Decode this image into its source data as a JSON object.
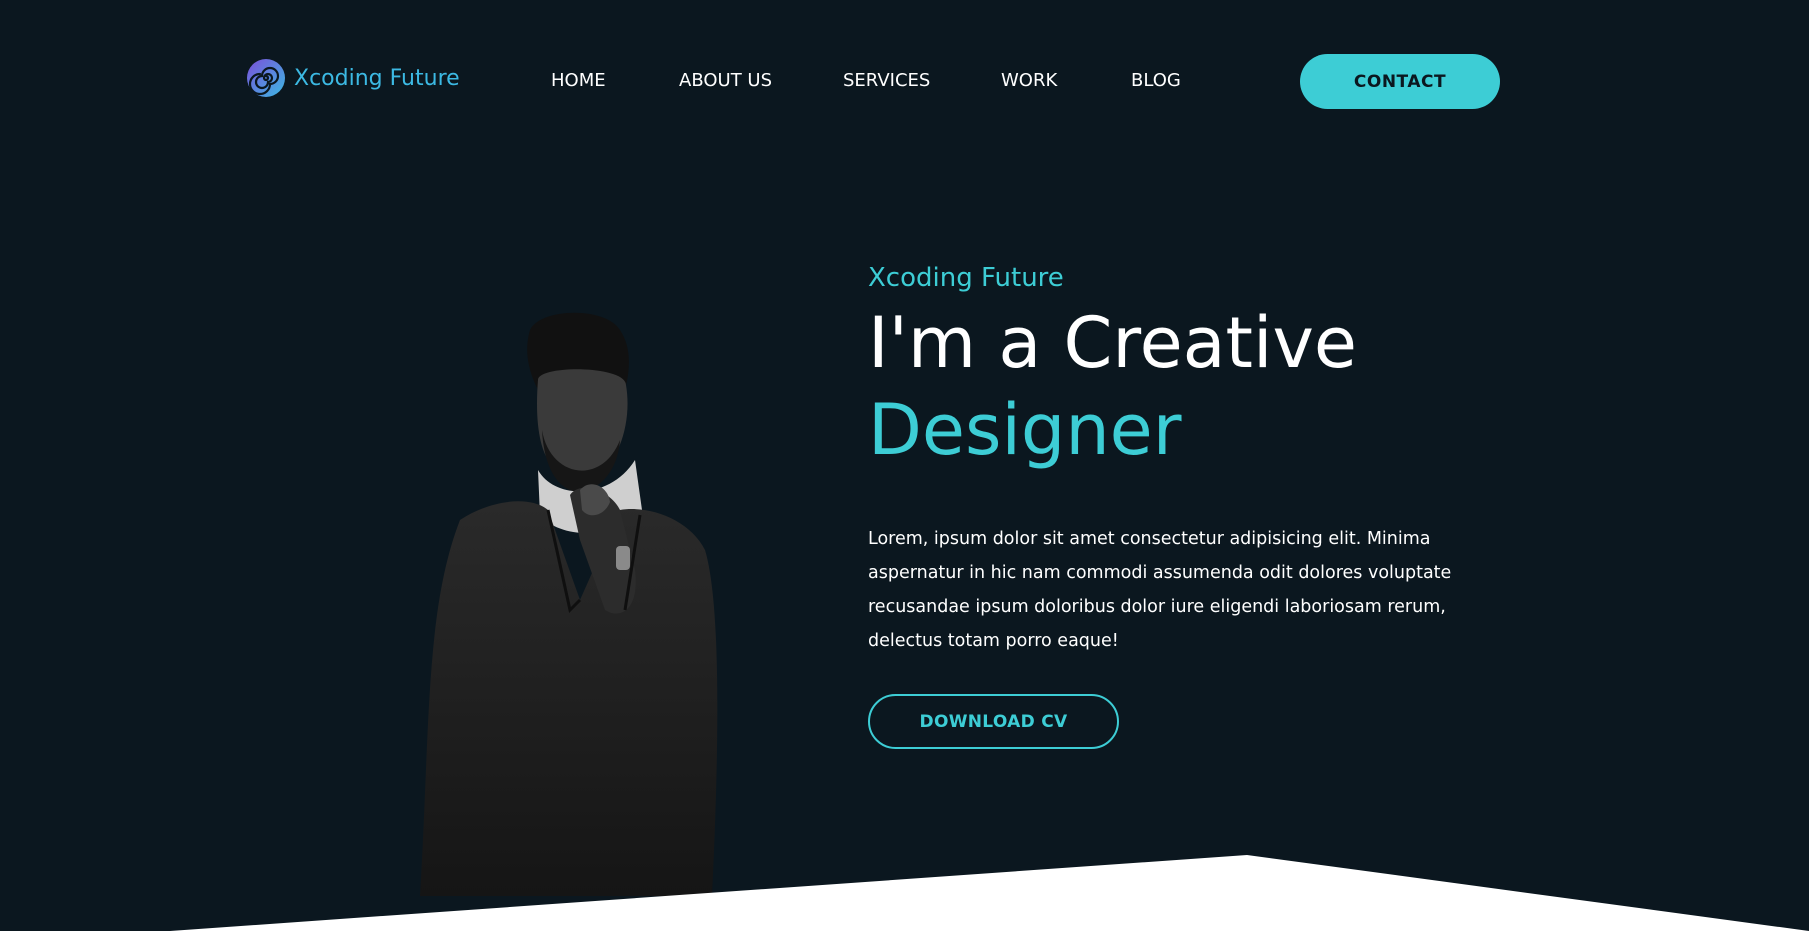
{
  "brand": {
    "name": "Xcoding Future",
    "logo_icon": "spiral-logo-icon"
  },
  "nav": {
    "items": [
      {
        "label": "HOME"
      },
      {
        "label": "ABOUT US"
      },
      {
        "label": "SERVICES"
      },
      {
        "label": "WORK"
      },
      {
        "label": "BLOG"
      }
    ],
    "contact_label": "CONTACT"
  },
  "hero": {
    "subtitle": "Xcoding Future",
    "title_line1": "I'm a Creative",
    "title_line2": "Designer",
    "body": "Lorem, ipsum dolor sit amet consectetur adipisicing elit. Minima aspernatur in hic nam commodi assumenda odit dolores voluptate recusandae ipsum doloribus dolor iure eligendi laboriosam rerum, delectus totam porro eaque!",
    "cta_label": "DOWNLOAD CV",
    "image": "portrait-of-man-in-coat"
  },
  "colors": {
    "background": "#0b171f",
    "accent": "#3dcdd5",
    "text": "#ffffff",
    "logo_text": "#3cb9e3"
  }
}
